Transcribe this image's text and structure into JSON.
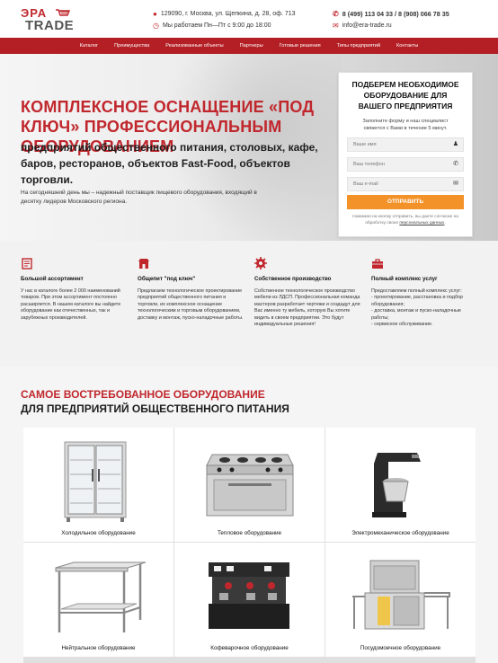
{
  "header": {
    "logo_top": "ЭРА",
    "logo_bottom": "TRADE",
    "address": "129090, г. Москва, ул. Щепкина, д. 28, оф. 713",
    "hours": "Мы работаем Пн—Пт с 9:00 до 18:00",
    "phones": "8 (499) 113 04 33 / 8 (908) 066 78 35",
    "email": "info@era-trade.ru"
  },
  "nav": [
    "Каталог",
    "Преимущества",
    "Реализованные объекты",
    "Партнеры",
    "Готовые решения",
    "Типы предприятий",
    "Контакты"
  ],
  "hero": {
    "title": "КОМПЛЕКСНОЕ ОСНАЩЕНИЕ «ПОД КЛЮЧ» ПРОФЕССИОНАЛЬНЫМ ОБОРУДОВАНИЕМ",
    "subtitle": "предприятий общественного питания, столовых, кафе, баров, ресторанов, объектов Fast-Food, объектов торговли.",
    "text": "На сегодняшний день мы – надежный поставщик пищевого оборудования, входящий в десятку лидеров Московского региона."
  },
  "form": {
    "title": "ПОДБЕРЕМ НЕОБХОДИМОЕ ОБОРУДОВАНИЕ ДЛЯ ВАШЕГО ПРЕДПРИЯТИЯ",
    "subtitle": "Заполните форму и наш специалист свяжется с Вами в течение 5 минут.",
    "name_placeholder": "Ваше имя",
    "phone_placeholder": "Ваш телефон",
    "email_placeholder": "Ваш e-mail",
    "button": "ОТПРАВИТЬ",
    "note_prefix": "Нажимая на кнопку отправить, вы даете согласие на обработку своих ",
    "note_link": "персональных данных",
    "note_suffix": "."
  },
  "features": [
    {
      "icon": "catalog-icon",
      "title": "Большой ассортимент",
      "text": "У нас в каталоге более 2 000 наименований товаров. При этом ассортимент постоянно расширяется. В нашем каталоге вы найдете оборудование как отечественных, так и зарубежных производителей."
    },
    {
      "icon": "shop-icon",
      "title": "Общепит \"под ключ\"",
      "text": "Предлагаем технологическое проектирование предприятий общественного питания и торговли, их комплексное оснащение технологическим и торговым оборудованием, доставку и монтаж, пуско-наладочные работы."
    },
    {
      "icon": "gear-icon",
      "title": "Собственное производство",
      "text": "Собственное технологическое производство мебели из ЛДСП. Профессиональная команда мастеров разработает чертежи и создадут для Вас именно ту мебель, которую Вы хотите видеть в своем предприятии. Это будут индивидуальные решения!"
    },
    {
      "icon": "toolbox-icon",
      "title": "Полный комплекс услуг",
      "text": "Предоставляем полный комплекс услуг:\n- проектирование, расстановка и подбор оборудования;\n- доставка, монтаж и пуско-наладочные работы;\n- сервисное обслуживание."
    }
  ],
  "popular": {
    "title_red": "САМОЕ ВОСТРЕБОВАННОЕ ОБОРУДОВАНИЕ",
    "title_dark": "ДЛЯ ПРЕДПРИЯТИЙ ОБЩЕСТВЕННОГО ПИТАНИЯ",
    "items": [
      {
        "label": "Холодильное оборудование",
        "image": "refrigerator-image"
      },
      {
        "label": "Тепловое оборудование",
        "image": "stove-image"
      },
      {
        "label": "Электромеханическое оборудование",
        "image": "mixer-image"
      },
      {
        "label": "Нейтральное оборудование",
        "image": "steel-table-image"
      },
      {
        "label": "Кофеварочное оборудование",
        "image": "coffee-machine-image"
      },
      {
        "label": "Посудомоечное оборудование",
        "image": "dishwasher-image"
      }
    ]
  },
  "colors": {
    "brand_red": "#c0272d",
    "nav_red": "#b41f25",
    "button_orange": "#f39229"
  }
}
